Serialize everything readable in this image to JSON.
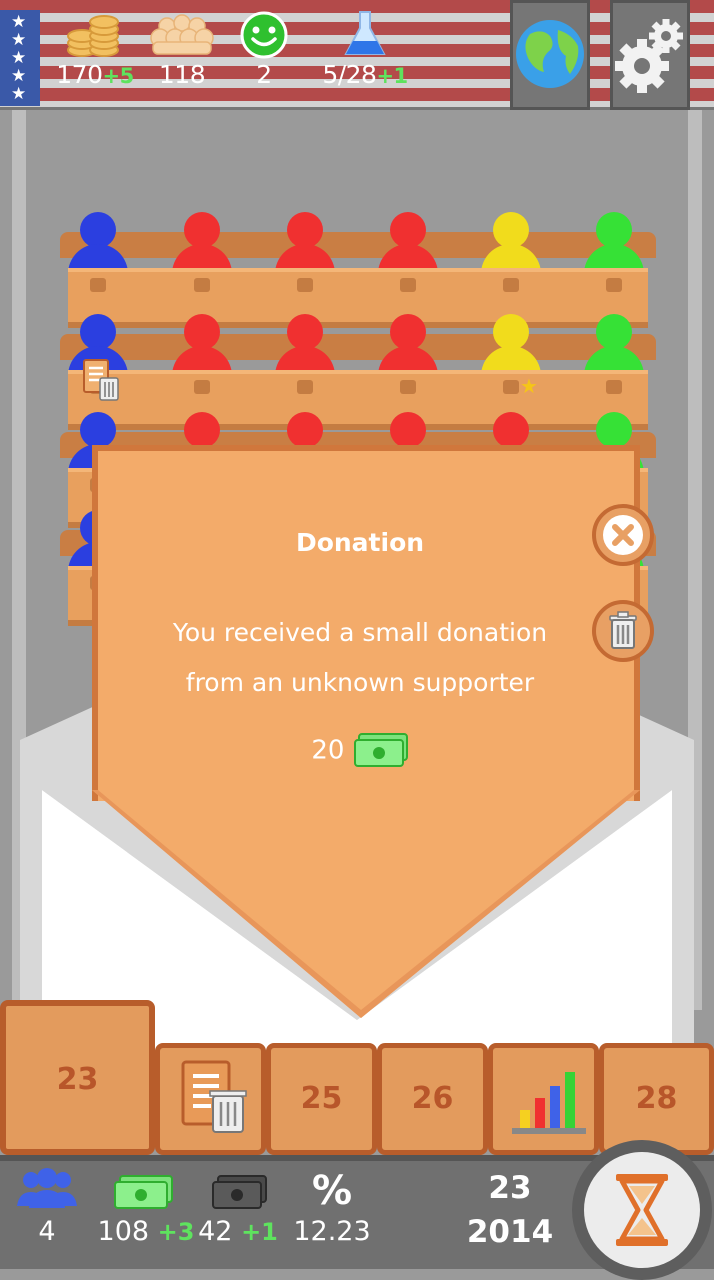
{
  "top": {
    "coins": {
      "value": "170",
      "delta": "+5",
      "icon": "coins-icon"
    },
    "population": {
      "value": "118",
      "icon": "crowd-icon"
    },
    "happiness": {
      "value": "2",
      "icon": "smiley-icon"
    },
    "research": {
      "value": "5/28",
      "delta": "+1",
      "icon": "flask-icon"
    },
    "globe_button": {
      "icon": "globe-icon"
    },
    "settings_button": {
      "icon": "gear-icon"
    }
  },
  "parliament": {
    "colors": {
      "blue": "#2b3fe0",
      "red": "#f03030",
      "yellow": "#f1dc1c",
      "green": "#36e136"
    },
    "rows": [
      [
        "blue",
        "red",
        "red",
        "red",
        "yellow",
        "green"
      ],
      [
        "blue",
        "red",
        "red",
        "red",
        "yellow",
        "green"
      ],
      [
        "blue",
        "red",
        "red",
        "red",
        "red",
        "green"
      ]
    ]
  },
  "popup": {
    "title": "Donation",
    "message_line1": "You received a small donation",
    "message_line2": "from an unknown supporter",
    "amount": "20",
    "amount_icon": "cash-icon",
    "close_icon": "close-icon",
    "delete_icon": "trash-icon"
  },
  "tabs": {
    "items": [
      "23",
      "",
      "25",
      "26",
      "",
      "28"
    ],
    "icons": [
      "",
      "document-trash-icon",
      "",
      "",
      "bar-chart-icon",
      ""
    ]
  },
  "bottom": {
    "voters": {
      "value": "4",
      "icon": "people-icon"
    },
    "cash": {
      "value": "108",
      "delta": "+3"
    },
    "black_money": {
      "value": "42",
      "delta": "+1"
    },
    "percent": {
      "symbol": "%",
      "value": "12.23"
    },
    "day": "23",
    "year": "2014",
    "end_turn_icon": "hourglass-icon"
  }
}
